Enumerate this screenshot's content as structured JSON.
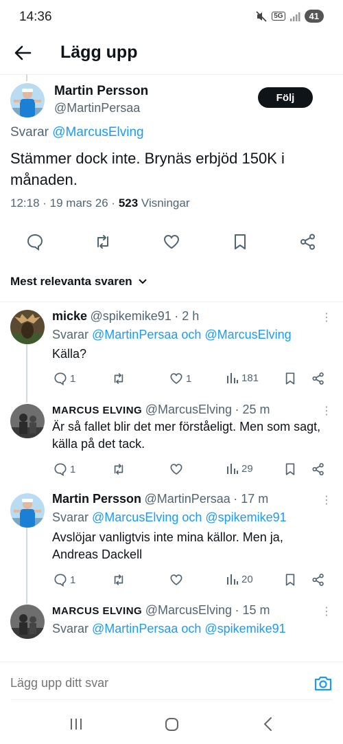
{
  "status_bar": {
    "time": "14:36",
    "network": "5G",
    "battery": "41"
  },
  "header": {
    "title": "Lägg upp"
  },
  "main_post": {
    "name": "Martin Persson",
    "handle": "@MartinPersaa",
    "follow_label": "Följ",
    "replying_prefix": "Svarar",
    "replying_to": "@MarcusElving",
    "text": "Stämmer dock inte. Brynäs erbjöd 150K i månaden.",
    "meta_date": "12:18 · 19 mars 26 · ",
    "views_count": "523",
    "views_label": " Visningar"
  },
  "sort": {
    "label": "Mest relevanta svaren"
  },
  "replies": [
    {
      "name": "micke",
      "handle": "@spikemike91",
      "time": "· 2 h",
      "replying_prefix": "Svarar",
      "replying_to": "@MartinPersaa och @MarcusElving",
      "text": "Källa?",
      "comments": "1",
      "likes": "1",
      "views": "181"
    },
    {
      "name": "MARCUS ELVING",
      "handle": "@MarcusElving",
      "time": "· 25 m",
      "text": "Är så fallet blir det mer förståeligt. Men som sagt, källa på det tack.",
      "comments": "1",
      "views": "29"
    },
    {
      "name": "Martin Persson",
      "handle": "@MartinPersaa",
      "time": "· 17 m",
      "replying_prefix": "Svarar",
      "replying_to": "@MarcusElving och @spikemike91",
      "text": "Avslöjar vanligtvis inte mina källor. Men ja, Andreas Dackell",
      "comments": "1",
      "views": "20"
    },
    {
      "name": "MARCUS ELVING",
      "handle": "@MarcusElving",
      "time": "· 15 m",
      "replying_prefix": "Svarar",
      "replying_to": "@MartinPersaa och @spikemike91"
    }
  ],
  "composer": {
    "placeholder": "Lägg upp ditt svar"
  },
  "colors": {
    "link": "#1d9bf0",
    "text": "#0f1419",
    "secondary": "#536471",
    "follow_bg": "#0f1419"
  }
}
